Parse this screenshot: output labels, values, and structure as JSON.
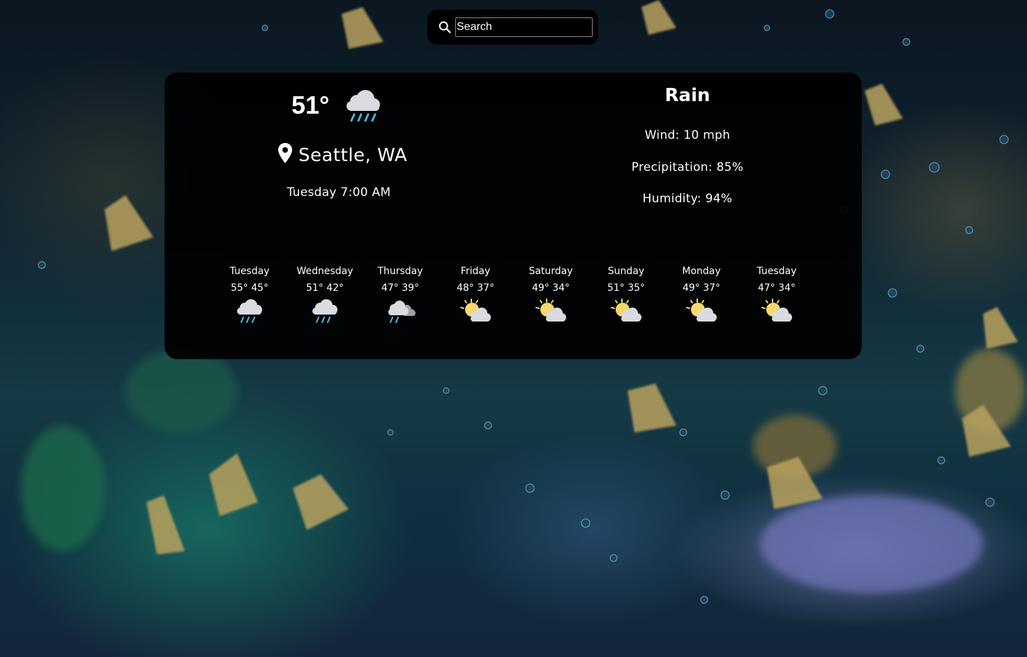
{
  "search": {
    "placeholder": "Search",
    "icon": "search-icon"
  },
  "current": {
    "temperature": "51°",
    "icon": "rain-cloud-icon",
    "location": "Seattle, WA",
    "datetime": "Tuesday 7:00 AM",
    "condition": "Rain",
    "wind": "Wind: 10 mph",
    "precipitation": "Precipitation: 85%",
    "humidity": "Humidity: 94%"
  },
  "forecast": [
    {
      "day": "Tuesday",
      "temps": "55° 45°",
      "icon": "rain-cloud-icon"
    },
    {
      "day": "Wednesday",
      "temps": "51° 42°",
      "icon": "rain-cloud-icon"
    },
    {
      "day": "Thursday",
      "temps": "47° 39°",
      "icon": "rain-partly-cloudy-icon"
    },
    {
      "day": "Friday",
      "temps": "48° 37°",
      "icon": "partly-sunny-icon"
    },
    {
      "day": "Saturday",
      "temps": "49° 34°",
      "icon": "partly-sunny-icon"
    },
    {
      "day": "Sunday",
      "temps": "51° 35°",
      "icon": "partly-sunny-icon"
    },
    {
      "day": "Monday",
      "temps": "49° 37°",
      "icon": "partly-sunny-icon"
    },
    {
      "day": "Tuesday",
      "temps": "47° 34°",
      "icon": "partly-sunny-icon"
    }
  ],
  "colors": {
    "card_background": "#000000",
    "rain_drop": "#4fb3d9",
    "cloud": "#d9dbe0",
    "sun": "#f5d76e"
  }
}
